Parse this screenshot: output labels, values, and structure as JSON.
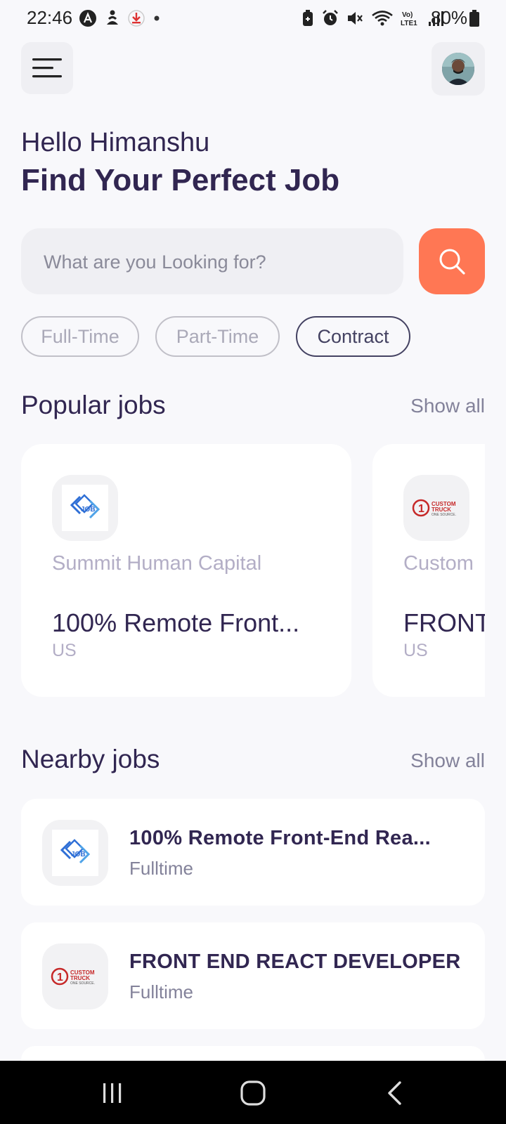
{
  "status_bar": {
    "time": "22:46",
    "battery": "80%"
  },
  "header": {
    "greeting": "Hello Himanshu",
    "headline": "Find Your Perfect Job"
  },
  "search": {
    "placeholder": "What are you Looking for?"
  },
  "job_types": [
    {
      "label": "Full-Time",
      "active": false
    },
    {
      "label": "Part-Time",
      "active": false
    },
    {
      "label": "Contract",
      "active": true
    }
  ],
  "popular": {
    "title": "Popular jobs",
    "show_all": "Show all",
    "cards": [
      {
        "company": "Summit Human Capital",
        "title": "100% Remote Front...",
        "location": "US",
        "logo": "job-logo"
      },
      {
        "company": "Custom",
        "title": "FRONT",
        "location": "US",
        "logo": "custom-truck-logo"
      }
    ]
  },
  "nearby": {
    "title": "Nearby jobs",
    "show_all": "Show all",
    "items": [
      {
        "title": "100% Remote Front-End Rea...",
        "type": "Fulltime",
        "logo": "job-logo"
      },
      {
        "title": "FRONT END REACT DEVELOPER",
        "type": "Fulltime",
        "logo": "custom-truck-logo"
      }
    ]
  },
  "colors": {
    "accent": "#FF7754",
    "primary_text": "#312651",
    "background": "#F8F8FB"
  }
}
